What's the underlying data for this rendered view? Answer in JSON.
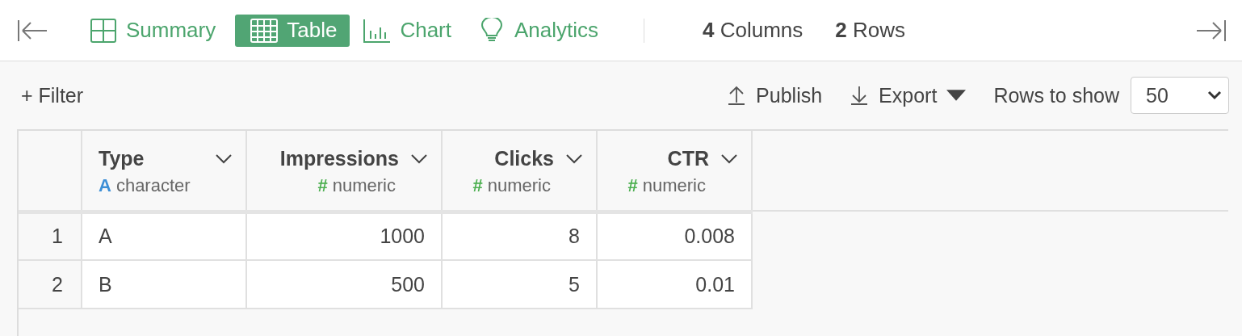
{
  "tabs": [
    {
      "label": "Summary",
      "kind": "summary",
      "selected": false
    },
    {
      "label": "Table",
      "kind": "table",
      "selected": true
    },
    {
      "label": "Chart",
      "kind": "chart",
      "selected": false
    },
    {
      "label": "Analytics",
      "kind": "analytics",
      "selected": false
    }
  ],
  "counts": [
    "**4** Columns",
    "**2** Rows"
  ],
  "toolbar": {
    "filter": "+ Filter",
    "publish": "Publish",
    "export": "Export",
    "rows_label": "Rows to show",
    "rows_value": "50"
  },
  "table": {
    "columns": [
      {
        "name": "Type",
        "type_mark": "A",
        "type": "character",
        "kind": "text"
      },
      {
        "name": "Impressions",
        "type_mark": "#",
        "type": "numeric",
        "kind": "number"
      },
      {
        "name": "Clicks",
        "type_mark": "#",
        "type": "numeric",
        "kind": "number"
      },
      {
        "name": "CTR",
        "type_mark": "#",
        "type": "numeric",
        "kind": "number"
      }
    ],
    "rows": [
      {
        "index": "1",
        "cells": [
          "A",
          "1000",
          "8",
          "0.008"
        ]
      },
      {
        "index": "2",
        "cells": [
          "B",
          "500",
          "5",
          "0.01"
        ]
      }
    ]
  }
}
